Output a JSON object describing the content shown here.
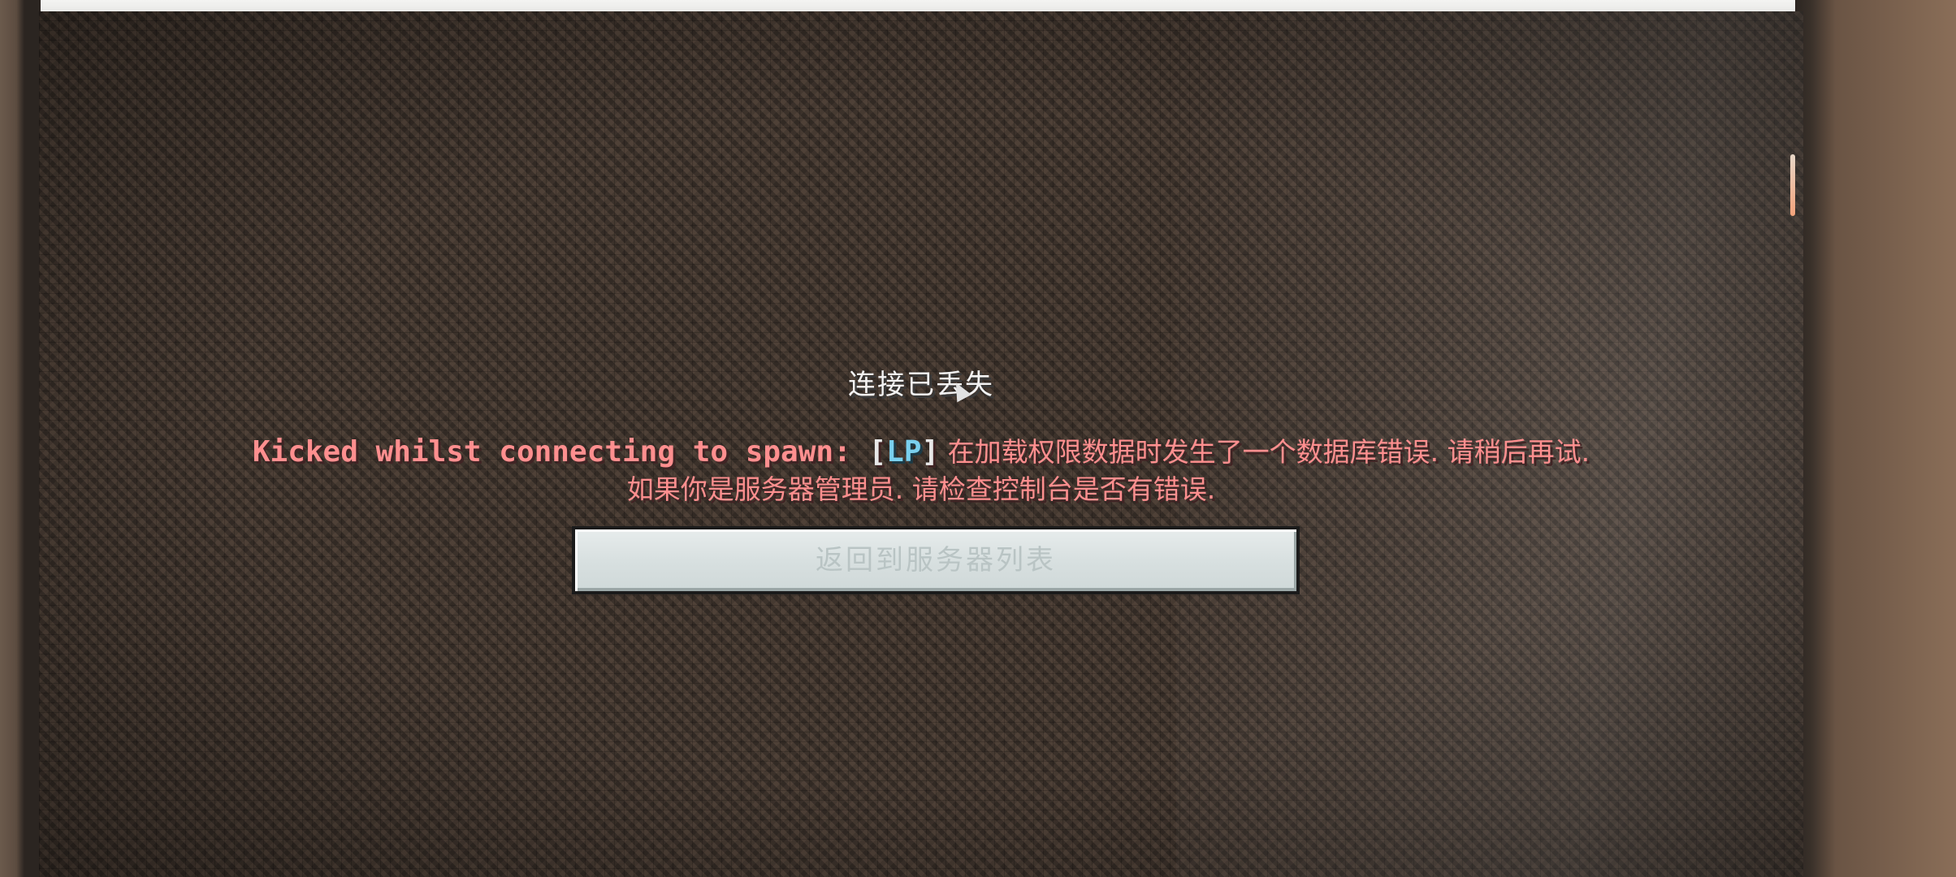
{
  "screen": {
    "title": "连接已丢失",
    "message": {
      "prefix": "Kicked whilst connecting to spawn: ",
      "bracket_open": "[",
      "tag": "LP",
      "bracket_close": "]",
      "line1_cn": " 在加载权限数据时发生了一个数据库错误. 请稍后再试.",
      "line2_cn": "如果你是服务器管理员. 请检查控制台是否有错误."
    },
    "button": {
      "label": "返回到服务器列表"
    }
  },
  "colors": {
    "title": "#f3f3f3",
    "message": "#ff8f8f",
    "tag": "#7ad0ee",
    "button_bg": "#dfe6e6"
  },
  "icons": {
    "cursor": "mouse-pointer-icon"
  }
}
